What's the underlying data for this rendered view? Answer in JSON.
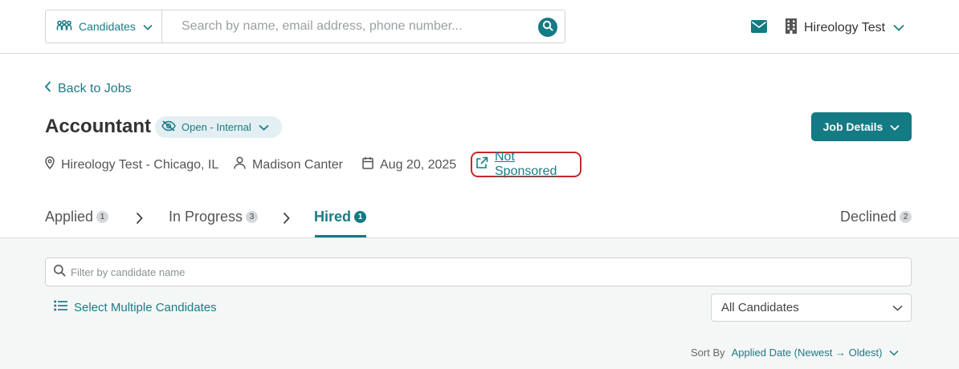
{
  "topbar": {
    "scope_label": "Candidates",
    "search_placeholder": "Search by name, email address, phone number...",
    "company": "Hireology Test"
  },
  "header": {
    "back_label": "Back to Jobs",
    "job_title": "Accountant",
    "status": "Open - Internal",
    "job_details_label": "Job Details",
    "location": "Hireology Test - Chicago, IL",
    "recruiter": "Madison Canter",
    "date": "Aug 20, 2025",
    "sponsorship": "Not Sponsored"
  },
  "tabs": [
    {
      "label": "Applied",
      "count": "1"
    },
    {
      "label": "In Progress",
      "count": "3"
    },
    {
      "label": "Hired",
      "count": "1",
      "active": true
    },
    {
      "label": "Declined",
      "count": "2"
    }
  ],
  "panel": {
    "filter_placeholder": "Filter by candidate name",
    "select_multiple_label": "Select Multiple Candidates",
    "candidate_filter": "All Candidates",
    "sort_label": "Sort By",
    "sort_value": "Applied Date (Newest → Oldest)"
  },
  "colors": {
    "accent": "#147a83",
    "highlight": "#c62828"
  }
}
